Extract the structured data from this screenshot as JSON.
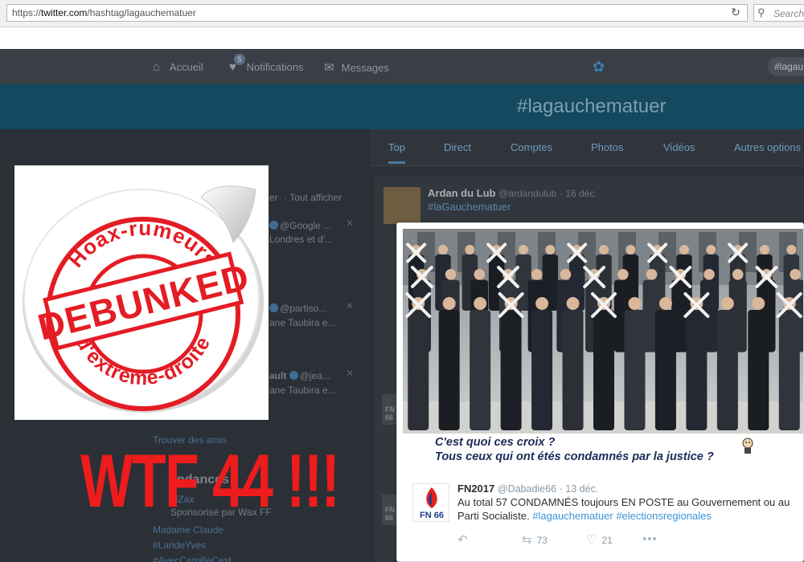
{
  "browser": {
    "url_prefix": "https://",
    "url_host": "twitter.com",
    "url_path": "/hashtag/lagauchematuer",
    "search_placeholder": "Search"
  },
  "nav": {
    "home": "Accueil",
    "notifications": "Notifications",
    "notification_count": "5",
    "messages": "Messages",
    "search_value": "#lagau"
  },
  "hero": {
    "title": "#lagauchematuer"
  },
  "tabs": [
    {
      "label": "Top"
    },
    {
      "label": "Direct"
    },
    {
      "label": "Comptes"
    },
    {
      "label": "Photos"
    },
    {
      "label": "Vidéos"
    },
    {
      "label": "Autres options"
    }
  ],
  "left_column": {
    "header_tail": "er",
    "view_all": "· Tout afficher",
    "sugg1_handle": "@Google ...",
    "sugg1_line": "Londres et d'...",
    "sugg2_handle": "@partiso...",
    "sugg2_line": "ane Taubira e...",
    "sugg3_name": "ault",
    "sugg3_handle": "@jea...",
    "sugg3_line": "ane Taubira e...",
    "find_friends": "Trouver des amis",
    "trends_head": "ndances",
    "trend1": "elZax",
    "trend1_sub": "Sponsorisé par Wax FF",
    "trend2": "Madame Claude",
    "trend3": "#LandeYves",
    "trend4": "#AvecCamilleCest"
  },
  "tweet_top": {
    "name": "Ardan du Lub",
    "handle": "@ardandulub",
    "date": "· 16 déc.",
    "hashtag": "#laGauchematuer"
  },
  "sticker": {
    "top_text": "Hoax-rumeurs",
    "center_text": "DEBUNKED",
    "bottom_text": "d'extrême-droite"
  },
  "overlay_text": "WTF 44 !!!",
  "photo_caption": {
    "line1": "C'est quoi ces croix ?",
    "line2": "Tous ceux qui ont étés condamnés par la justice ?"
  },
  "fn_tweet": {
    "avatar_text": "FN 66",
    "name": "FN2017",
    "handle": "@Dabadie66",
    "date": "· 13 déc.",
    "text": "Au total 57 CONDAMNÉS toujours EN POSTE au Gouvernement ou au Parti Socialiste.",
    "tag1": "#lagauchematuer",
    "tag2": "#electionsregionales",
    "retweets": "73",
    "likes": "21"
  },
  "colors": {
    "tweet_link": "#3b94d9",
    "overlay_red": "#ee1c1c",
    "sticker_red": "#e41c24",
    "caption_navy": "#1d2b58"
  }
}
